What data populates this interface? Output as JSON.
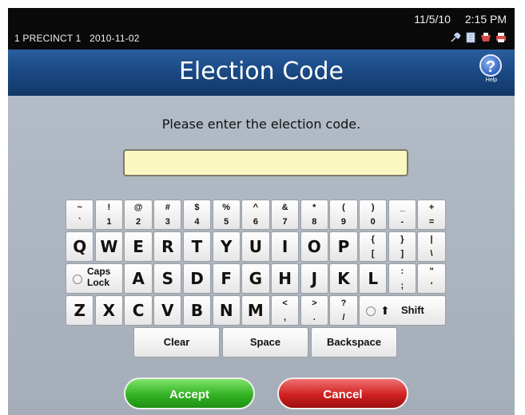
{
  "status": {
    "precinct": "1 PRECINCT 1",
    "date_code": "2010-11-02",
    "date": "11/5/10",
    "time": "2:15 PM",
    "icons": [
      "plug-icon",
      "document-icon",
      "ballot-icon",
      "printer-icon"
    ]
  },
  "title": "Election Code",
  "help_label": "Help",
  "help_symbol": "?",
  "prompt": "Please enter the election code.",
  "code_input": {
    "value": "",
    "placeholder": ""
  },
  "keyboard": {
    "row1": [
      {
        "top": "~",
        "bot": "`"
      },
      {
        "top": "!",
        "bot": "1"
      },
      {
        "top": "@",
        "bot": "2"
      },
      {
        "top": "#",
        "bot": "3"
      },
      {
        "top": "$",
        "bot": "4"
      },
      {
        "top": "%",
        "bot": "5"
      },
      {
        "top": "^",
        "bot": "6"
      },
      {
        "top": "&",
        "bot": "7"
      },
      {
        "top": "*",
        "bot": "8"
      },
      {
        "top": "(",
        "bot": "9"
      },
      {
        "top": ")",
        "bot": "0"
      },
      {
        "top": "_",
        "bot": "-"
      },
      {
        "top": "+",
        "bot": "="
      }
    ],
    "row2": [
      "Q",
      "W",
      "E",
      "R",
      "T",
      "Y",
      "U",
      "I",
      "O",
      "P"
    ],
    "row2_dual": [
      {
        "top": "{",
        "bot": "["
      },
      {
        "top": "}",
        "bot": "]"
      },
      {
        "top": "|",
        "bot": "\\"
      }
    ],
    "caps_label_1": "Caps",
    "caps_label_2": "Lock",
    "row3": [
      "A",
      "S",
      "D",
      "F",
      "G",
      "H",
      "J",
      "K",
      "L"
    ],
    "row3_dual": [
      {
        "top": ":",
        "bot": ";"
      },
      {
        "top": "\"",
        "bot": "'"
      }
    ],
    "row4": [
      "Z",
      "X",
      "C",
      "V",
      "B",
      "N",
      "M"
    ],
    "row4_dual": [
      {
        "top": "<",
        "bot": ","
      },
      {
        "top": ">",
        "bot": "."
      },
      {
        "top": "?",
        "bot": "/"
      }
    ],
    "shift_label": "Shift",
    "shift_arrow": "⬆",
    "clear_label": "Clear",
    "space_label": "Space",
    "backspace_label": "Backspace"
  },
  "accept_label": "Accept",
  "cancel_label": "Cancel",
  "colors": {
    "title_bar": "#1b4a86",
    "input_bg": "#fbf7c0",
    "accept": "#33b323",
    "cancel": "#d12020"
  }
}
